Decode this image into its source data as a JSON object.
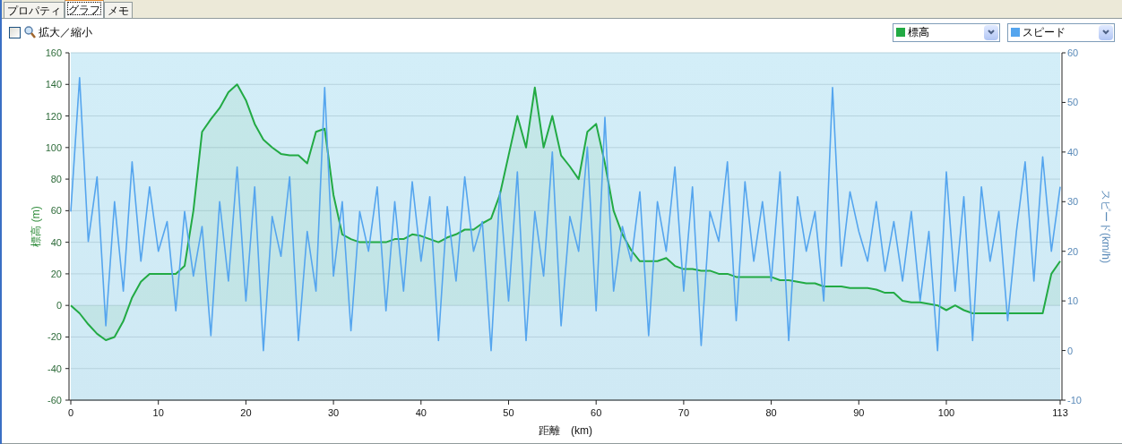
{
  "tabs": [
    {
      "label": "プロパティ",
      "selected": false
    },
    {
      "label": "グラフ",
      "selected": true
    },
    {
      "label": "メモ",
      "selected": false
    }
  ],
  "toolbar": {
    "zoom_checkbox": {
      "label": "拡大／縮小",
      "checked": false
    }
  },
  "chart": {
    "chart_data": {
      "type": "line",
      "grid": true,
      "xlabel": "距離　(km)",
      "ylabel": "標高 (m)",
      "y2label": "スピード(km/h)",
      "xlim": [
        0,
        113
      ],
      "ylim": [
        -60,
        160
      ],
      "y2lim": [
        -10,
        60
      ],
      "xticks": [
        0,
        10,
        20,
        30,
        40,
        50,
        60,
        70,
        80,
        90,
        100,
        113
      ],
      "yticks": [
        -60,
        -40,
        -20,
        0,
        20,
        40,
        60,
        80,
        100,
        120,
        140,
        160
      ],
      "y2ticks": [
        -10,
        0,
        10,
        20,
        30,
        40,
        50,
        60
      ],
      "x": [
        0,
        1,
        2,
        3,
        4,
        5,
        6,
        7,
        8,
        9,
        10,
        11,
        12,
        13,
        14,
        15,
        16,
        17,
        18,
        19,
        20,
        21,
        22,
        23,
        24,
        25,
        26,
        27,
        28,
        29,
        30,
        31,
        32,
        33,
        34,
        35,
        36,
        37,
        38,
        39,
        40,
        41,
        42,
        43,
        44,
        45,
        46,
        47,
        48,
        49,
        50,
        51,
        52,
        53,
        54,
        55,
        56,
        57,
        58,
        59,
        60,
        61,
        62,
        63,
        64,
        65,
        66,
        67,
        68,
        69,
        70,
        71,
        72,
        73,
        74,
        75,
        76,
        77,
        78,
        79,
        80,
        81,
        82,
        83,
        84,
        85,
        86,
        87,
        88,
        89,
        90,
        91,
        92,
        93,
        94,
        95,
        96,
        97,
        98,
        99,
        100,
        101,
        102,
        103,
        104,
        105,
        106,
        107,
        108,
        109,
        110,
        111,
        112,
        113
      ],
      "series": [
        {
          "name": "標高",
          "color": "#22aa44",
          "values": [
            0,
            -5,
            -12,
            -18,
            -22,
            -20,
            -10,
            5,
            15,
            20,
            20,
            20,
            20,
            25,
            60,
            110,
            118,
            125,
            135,
            140,
            130,
            115,
            105,
            100,
            96,
            95,
            95,
            90,
            110,
            112,
            70,
            45,
            42,
            40,
            40,
            40,
            40,
            42,
            42,
            45,
            44,
            42,
            40,
            43,
            45,
            48,
            48,
            52,
            55,
            70,
            95,
            120,
            100,
            138,
            100,
            120,
            95,
            88,
            80,
            110,
            115,
            90,
            60,
            45,
            35,
            28,
            28,
            28,
            30,
            25,
            23,
            23,
            22,
            22,
            20,
            20,
            18,
            18,
            18,
            18,
            18,
            16,
            16,
            15,
            14,
            14,
            12,
            12,
            12,
            11,
            11,
            11,
            10,
            8,
            8,
            3,
            2,
            2,
            1,
            0,
            -3,
            0,
            -3,
            -5,
            -5,
            -5,
            -5,
            -5,
            -5,
            -5,
            -5,
            -5,
            20,
            28
          ]
        },
        {
          "name": "スピード",
          "color": "#55a5ee",
          "axis": "y2",
          "values": [
            28,
            55,
            22,
            35,
            5,
            30,
            12,
            38,
            18,
            33,
            20,
            26,
            8,
            28,
            15,
            25,
            3,
            30,
            14,
            37,
            10,
            33,
            0,
            27,
            19,
            35,
            2,
            24,
            12,
            53,
            15,
            30,
            4,
            28,
            20,
            33,
            8,
            30,
            12,
            34,
            18,
            31,
            2,
            29,
            14,
            35,
            20,
            26,
            0,
            32,
            10,
            36,
            2,
            28,
            15,
            40,
            5,
            27,
            20,
            41,
            8,
            47,
            12,
            25,
            18,
            32,
            3,
            30,
            20,
            37,
            12,
            33,
            1,
            28,
            22,
            38,
            6,
            34,
            18,
            30,
            14,
            36,
            2,
            31,
            20,
            28,
            10,
            53,
            17,
            32,
            24,
            18,
            30,
            16,
            26,
            14,
            28,
            10,
            24,
            0,
            36,
            12,
            31,
            2,
            33,
            18,
            28,
            6,
            24,
            38,
            14,
            39,
            20,
            33
          ]
        }
      ]
    }
  }
}
